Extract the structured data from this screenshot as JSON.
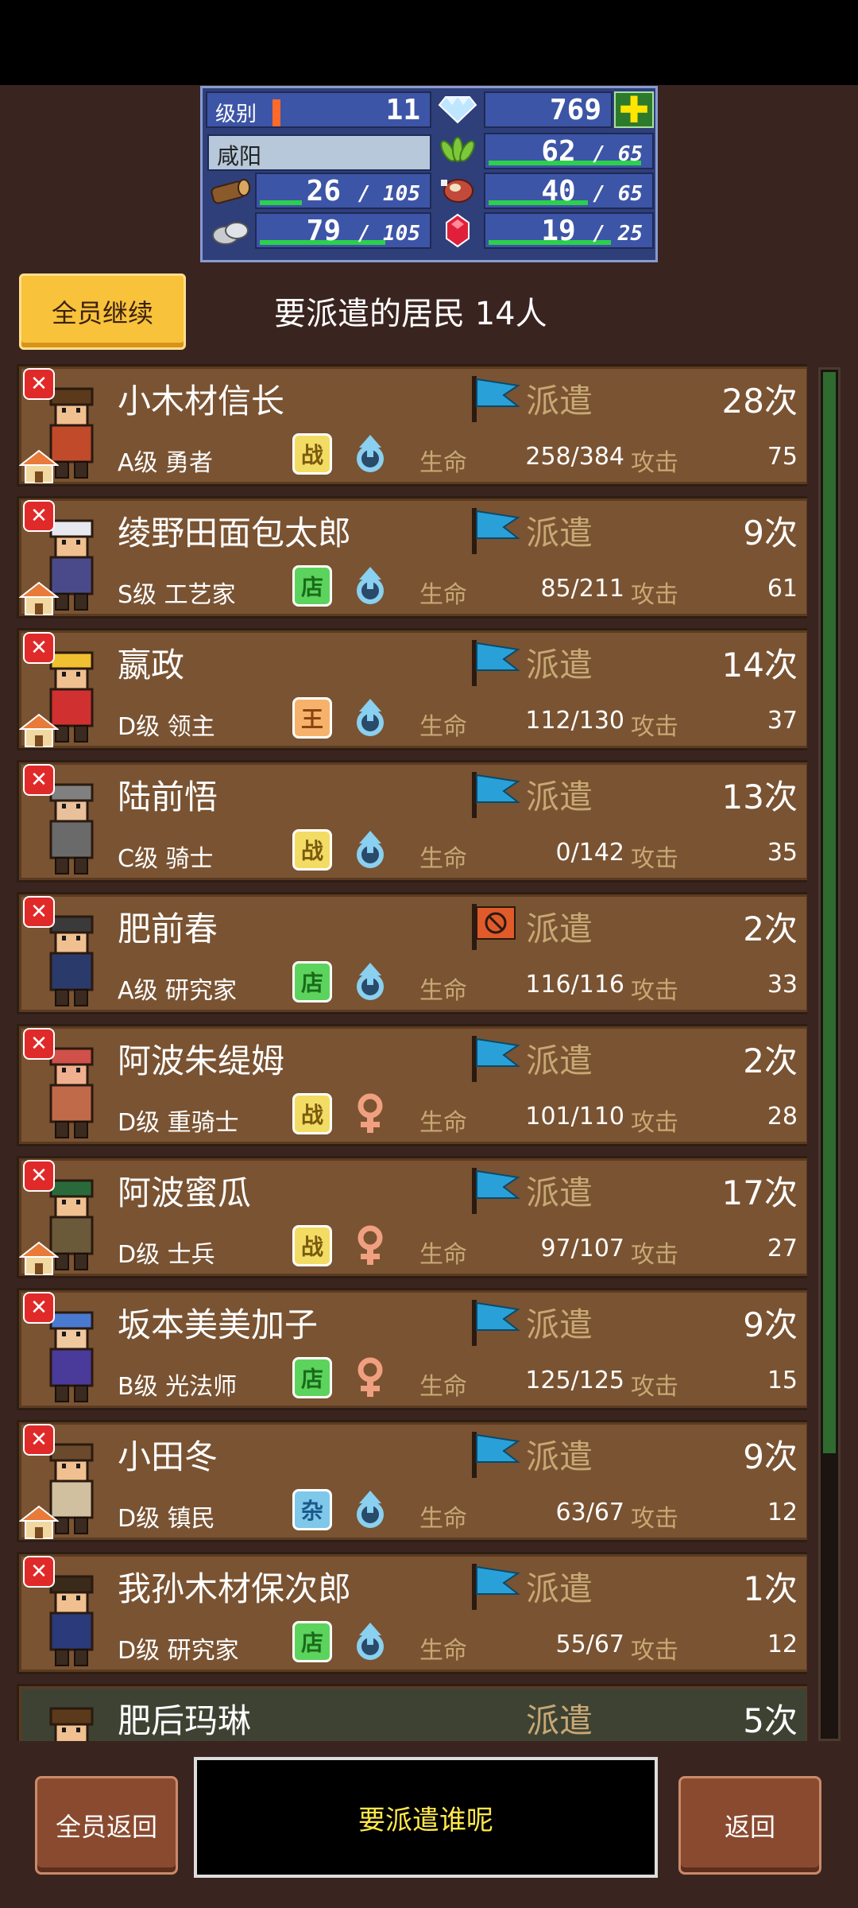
{
  "resources": {
    "level_label": "级别",
    "level_value": "11",
    "gems": "769",
    "city_name": "咸阳",
    "food": {
      "value": "62",
      "cap": "65",
      "fill": 0.95
    },
    "wood": {
      "value": "26",
      "cap": "105",
      "fill": 0.25
    },
    "meat": {
      "value": "40",
      "cap": "65",
      "fill": 0.62
    },
    "stone": {
      "value": "79",
      "cap": "105",
      "fill": 0.75
    },
    "ruby": {
      "value": "19",
      "cap": "25",
      "fill": 0.76
    },
    "level_fill": 0.05
  },
  "header": {
    "all_continue": "全员继续",
    "title": "要派遣的居民 14人"
  },
  "common": {
    "dispatch": "派遣",
    "hp": "生命",
    "atk": "攻击"
  },
  "residents": [
    {
      "name": "小木材信长",
      "rank": "A级 勇者",
      "tag": "战",
      "tag_type": "war",
      "gender": "male",
      "hp": "258/384",
      "atk": "75",
      "times": "28次",
      "flag": "blue",
      "house": true
    },
    {
      "name": "绫野田面包太郎",
      "rank": "S级 工艺家",
      "tag": "店",
      "tag_type": "shop",
      "gender": "male",
      "hp": "85/211",
      "atk": "61",
      "times": "9次",
      "flag": "blue",
      "house": true
    },
    {
      "name": "嬴政",
      "rank": "D级 领主",
      "tag": "王",
      "tag_type": "king",
      "gender": "male",
      "hp": "112/130",
      "atk": "37",
      "times": "14次",
      "flag": "blue",
      "house": true
    },
    {
      "name": "陆前悟",
      "rank": "C级 骑士",
      "tag": "战",
      "tag_type": "war",
      "gender": "male",
      "hp": "0/142",
      "atk": "35",
      "times": "13次",
      "flag": "blue",
      "house": false
    },
    {
      "name": "肥前春",
      "rank": "A级 研究家",
      "tag": "店",
      "tag_type": "shop",
      "gender": "male",
      "hp": "116/116",
      "atk": "33",
      "times": "2次",
      "flag": "red",
      "house": false
    },
    {
      "name": "阿波朱缇姆",
      "rank": "D级 重骑士",
      "tag": "战",
      "tag_type": "war",
      "gender": "female",
      "hp": "101/110",
      "atk": "28",
      "times": "2次",
      "flag": "blue",
      "house": false
    },
    {
      "name": "阿波蜜瓜",
      "rank": "D级 士兵",
      "tag": "战",
      "tag_type": "war",
      "gender": "female",
      "hp": "97/107",
      "atk": "27",
      "times": "17次",
      "flag": "blue",
      "house": true
    },
    {
      "name": "坂本美美加子",
      "rank": "B级 光法师",
      "tag": "店",
      "tag_type": "shop",
      "gender": "female",
      "hp": "125/125",
      "atk": "15",
      "times": "9次",
      "flag": "blue",
      "house": false
    },
    {
      "name": "小田冬",
      "rank": "D级 镇民",
      "tag": "杂",
      "tag_type": "misc",
      "gender": "male",
      "hp": "63/67",
      "atk": "12",
      "times": "9次",
      "flag": "blue",
      "house": true
    },
    {
      "name": "我孙木材保次郎",
      "rank": "D级 研究家",
      "tag": "店",
      "tag_type": "shop",
      "gender": "male",
      "hp": "55/67",
      "atk": "12",
      "times": "1次",
      "flag": "blue",
      "house": false
    },
    {
      "name": "肥后玛琳",
      "rank": "",
      "tag": "",
      "tag_type": "",
      "gender": "",
      "hp": "",
      "atk": "",
      "times": "5次",
      "flag": "",
      "house": false,
      "partial": true
    }
  ],
  "footer": {
    "all_return": "全员返回",
    "message": "要派遣谁呢",
    "back": "返回"
  }
}
